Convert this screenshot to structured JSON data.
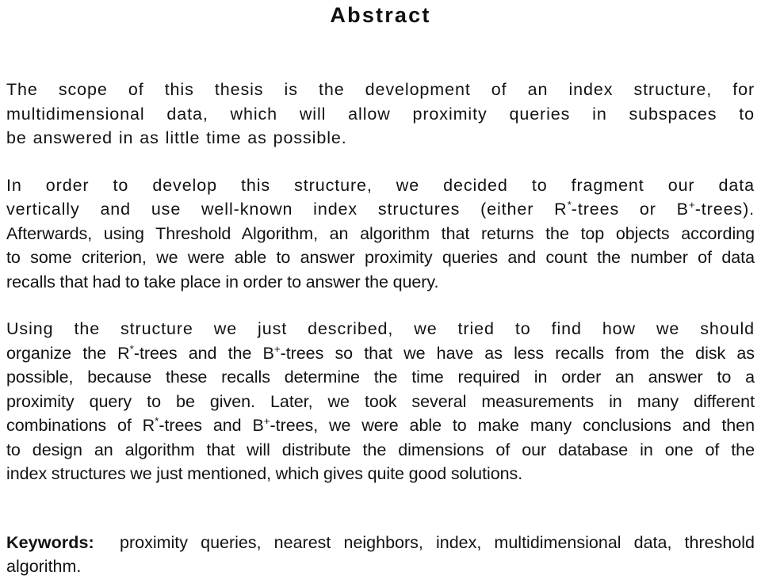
{
  "document": {
    "title": "Abstract",
    "text_color": "#121212",
    "background_color": "#ffffff"
  },
  "paragraphs": [
    {
      "id": "p1",
      "style": "wide",
      "full_text": "The scope of this thesis is the development of an index structure, for multidimensional data, which will allow proximity queries in subspaces to be answered in as little time as possible.",
      "lines": [
        "The scope of this thesis is the development of an index structure, for",
        "multidimensional data, which will allow proximity queries in subspaces to",
        "be answered in as little time as possible."
      ]
    },
    {
      "id": "p2",
      "style": "mixed",
      "full_text": "In order to develop this structure, we decided to fragment our data vertically and use well-known index structures (either R*-trees or B+-trees). Afterwards, using Threshold Algorithm, an algorithm that returns the top objects according to some criterion, we were able to answer proximity queries and count the number of data recalls that had to take place in order to answer the query.",
      "lines": [
        "In order to develop this structure, we decided to fragment our data",
        "vertically and use well-known index structures (either R*-trees or B+-trees).",
        "Afterwards, using Threshold Algorithm, an algorithm that returns the top objects according",
        "to some criterion, we were able to answer proximity queries and count the number of data",
        "recalls that had to take place in order to answer the query."
      ],
      "line2_parts": {
        "before_r": "vertically and use well-known index structures (either R",
        "r_sup": "*",
        "between": "-trees or B",
        "b_sup": "+",
        "after_b": "-trees)."
      }
    },
    {
      "id": "p3",
      "style": "mixed",
      "full_text": "Using the structure we just described, we tried to find how we should organize the R*-trees and the B+-trees so that we have as less recalls from the disk as possible, because these recalls determine the time required in order an answer to a proximity query to be given. Later, we took several measurements in many different combinations of R*-trees and B+-trees, we were able to make many conclusions and then to design an algorithm that will distribute the dimensions of our database in one of the index structures we just mentioned, which gives quite good solutions.",
      "lines": [
        "Using the structure we just described, we tried to find how we should",
        "organize the R*-trees and the B+-trees so that we have as less recalls from the disk as",
        "possible, because these recalls determine the time required in order an answer to a",
        "proximity query to be given. Later, we took several measurements in many different",
        "combinations of R*-trees and B+-trees, we were able to make many conclusions and then",
        "to design an algorithm that will distribute the dimensions of our database in one of the",
        "index structures we just mentioned, which gives quite good solutions."
      ],
      "line2_parts": {
        "before_r": "organize the R",
        "r_sup": "*",
        "between": "-trees and the B",
        "b_sup": "+",
        "after_b": "-trees so that we have as less recalls from the disk as"
      },
      "line5_parts": {
        "before_r": "combinations of R",
        "r_sup": "*",
        "between": "-trees and B",
        "b_sup": "+",
        "after_b": "-trees, we were able to make many conclusions and then"
      }
    }
  ],
  "keywords": {
    "label": "Keywords:",
    "line1": "proximity queries, nearest neighbors, index, multidimensional data, threshold",
    "line2": "algorithm.",
    "terms": [
      "proximity queries",
      "nearest neighbors",
      "index",
      "multidimensional data",
      "threshold algorithm"
    ]
  }
}
